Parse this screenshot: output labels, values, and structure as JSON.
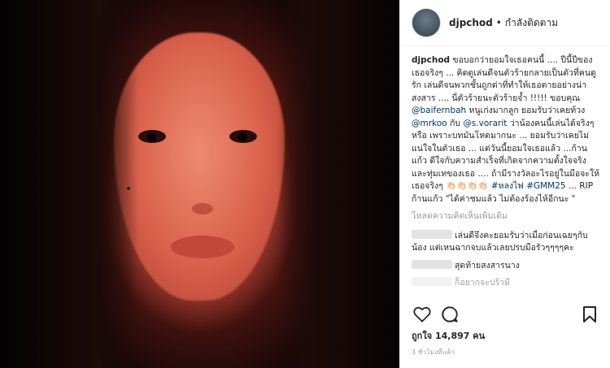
{
  "post": {
    "photo_alt": "",
    "username": "djpchod",
    "separator": "•",
    "follow_status": "กำลังติดตาม"
  },
  "caption": {
    "username": "djpchod",
    "text_1": " ขอบอกว่ายอมใจเธอคนนี้ .... ปีนี้ปีของเธอจริงๆ ... คิดดูเล่นดีจนตัวร้ายกลายเป็นตัวที่คนดูรัก เล่นดีจนพวกชั้นถูกด่าที่ทำให้เธอตายอย่างน่าสงสาร .... นี่ตัวร้ายนะตัวร้ายจ้ำ !!!!! ขอบคุณ ",
    "mention_1": "@baifernbah",
    "text_2": " หนูเก่งมากลูก ยอมรับว่าเคยท้วง ",
    "mention_2": "@mrkoo",
    "text_3": " กับ ",
    "mention_3": "@s.vorarit",
    "text_4": " ว่าน้องคนนี้เล่นได้จริงๆหรือ เพราะบทมันโหดมากนะ ... ยอมรับว่าเคยไม่แน่ใจในตัวเธอ ... แต่วันนี้ยอมใจเธอแล้ว ...ก้านแก้ว ดีใจกับความสำเร็จที่เกิดจากความตั้งใจจริงและทุ่มเทของเธอ .... ถ้ามีรางวัลอะไรอยู่ในมือจะให้เธอจริงๆ 👏🏻👏🏻👏🏻👏🏻 ",
    "hashtag_1": "#หลงไฟ",
    "hashtag_2": "#GMM25",
    "text_5": " ... RIP ก้านแก้ว \"ได้ค่าชมแล้ว ไม่ต้องร้องไห้อีกนะ \""
  },
  "load_more": "โหลดความคิดเห็นเพิ่มเติม",
  "comments": [
    {
      "text": "เล่นดีจึงคะยอมรับว่าเมื่อก่อนเฉยๆกับน้อง แต่เหนฉากจบแล้วเลยปรบมือรัวๆๆๆๆคะ"
    },
    {
      "text": "สุดท้ายสงสารนาง"
    },
    {
      "text": "ก็อยากจะปร้ามี"
    }
  ],
  "icons": {
    "like": "heart-outline-icon",
    "comment": "speech-bubble-icon",
    "save": "bookmark-icon"
  },
  "likes_text": "ถูกใจ 14,897 คน",
  "timestamp": "3 ชั่วโมงที่แล้ว"
}
